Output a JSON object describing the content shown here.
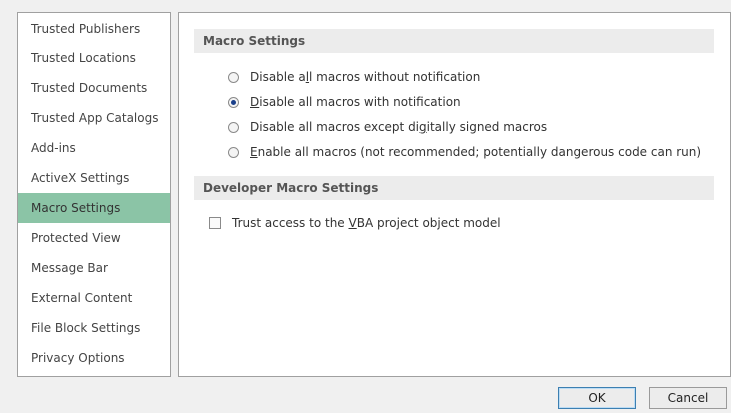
{
  "sidebar": {
    "items": [
      {
        "label": "Trusted Publishers"
      },
      {
        "label": "Trusted Locations"
      },
      {
        "label": "Trusted Documents"
      },
      {
        "label": "Trusted App Catalogs"
      },
      {
        "label": "Add-ins"
      },
      {
        "label": "ActiveX Settings"
      },
      {
        "label": "Macro Settings",
        "selected": true
      },
      {
        "label": "Protected View"
      },
      {
        "label": "Message Bar"
      },
      {
        "label": "External Content"
      },
      {
        "label": "File Block Settings"
      },
      {
        "label": "Privacy Options"
      }
    ]
  },
  "macro_settings": {
    "header": "Macro Settings",
    "options": [
      {
        "pre": "Disable a",
        "key": "l",
        "post": "l macros without notification",
        "checked": false
      },
      {
        "pre": "",
        "key": "D",
        "post": "isable all macros with notification",
        "checked": true
      },
      {
        "pre": "Disable all macros except di",
        "key": "g",
        "post": "itally signed macros",
        "checked": false
      },
      {
        "pre": "",
        "key": "E",
        "post": "nable all macros (not recommended; potentially dangerous code can run)",
        "checked": false
      }
    ]
  },
  "developer_settings": {
    "header": "Developer Macro Settings",
    "trust_vba": {
      "pre": "Trust access to the ",
      "key": "V",
      "post": "BA project object model",
      "checked": false
    }
  },
  "buttons": {
    "ok": "OK",
    "cancel": "Cancel"
  }
}
